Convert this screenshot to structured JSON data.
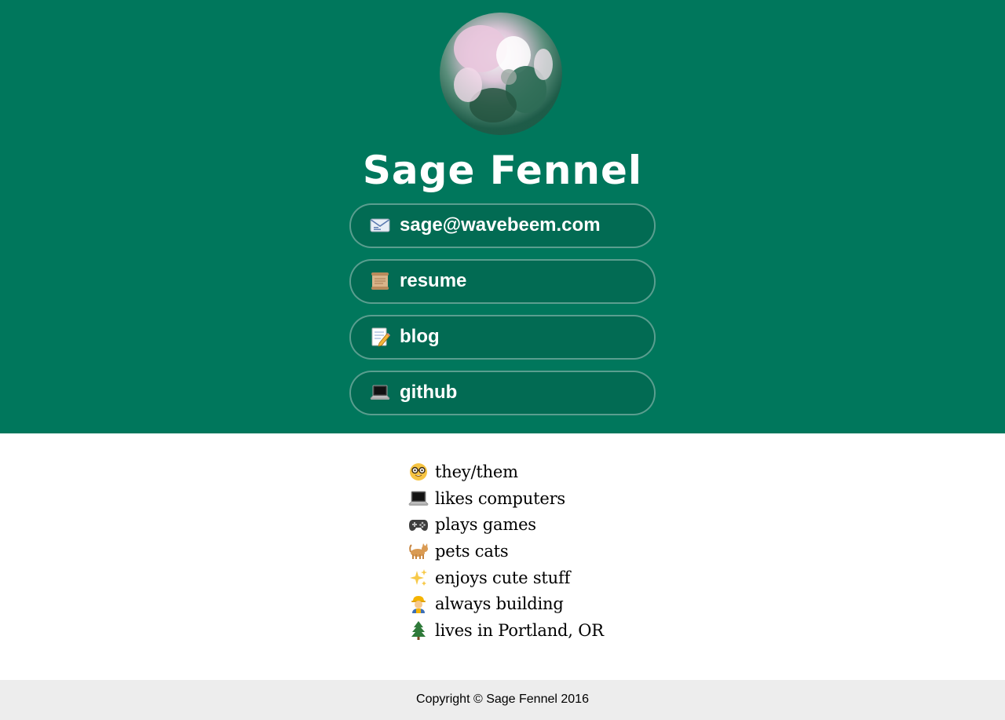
{
  "profile": {
    "name": "Sage Fennel"
  },
  "colors": {
    "header_bg": "#00775c",
    "button_bg": "#026b53",
    "footer_bg": "#ededed"
  },
  "links": [
    {
      "icon": "envelope-icon",
      "label": "sage@wavebeem.com"
    },
    {
      "icon": "scroll-icon",
      "label": "resume"
    },
    {
      "icon": "memo-icon",
      "label": "blog"
    },
    {
      "icon": "laptop-icon",
      "label": "github"
    }
  ],
  "facts": [
    {
      "icon": "nerd-face-icon",
      "text": "they/them"
    },
    {
      "icon": "laptop-icon",
      "text": "likes computers"
    },
    {
      "icon": "game-controller-icon",
      "text": "plays games"
    },
    {
      "icon": "cat-icon",
      "text": "pets cats"
    },
    {
      "icon": "sparkles-icon",
      "text": "enjoys cute stuff"
    },
    {
      "icon": "construction-worker-icon",
      "text": "always building"
    },
    {
      "icon": "evergreen-tree-icon",
      "text": "lives in Portland, OR"
    }
  ],
  "footer": {
    "copyright": "Copyright © Sage Fennel 2016"
  }
}
